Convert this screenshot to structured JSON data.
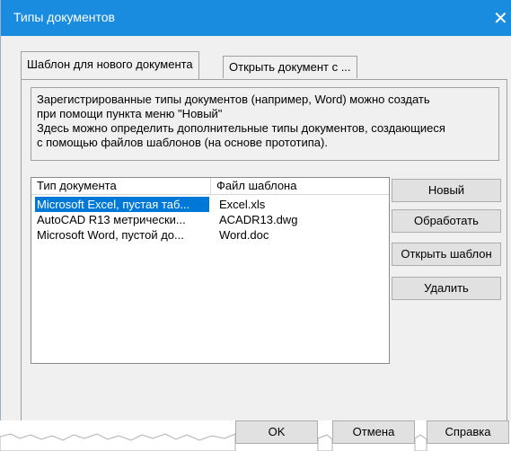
{
  "window": {
    "title": "Типы документов",
    "close_glyph": "✕"
  },
  "tabs": [
    {
      "label": "Шаблон для нового документа",
      "active": true
    },
    {
      "label": "Открыть документ с ...",
      "active": false
    }
  ],
  "description": {
    "lines": [
      "Зарегистрированные типы документов (например, Word) можно создать",
      "при помощи пункта меню \"Новый\"",
      "Здесь можно определить дополнительные типы документов, создающиеся",
      "с помощью файлов шаблонов (на основе прототипа)."
    ]
  },
  "list": {
    "columns": [
      "Тип документа",
      "Файл шаблона"
    ],
    "rows": [
      {
        "type": "Microsoft Excel, пустая таб...",
        "file": "Excel.xls",
        "selected": true
      },
      {
        "type": "AutoCAD R13 метрически...",
        "file": "ACADR13.dwg",
        "selected": false
      },
      {
        "type": "Microsoft Word, пустой до...",
        "file": "Word.doc",
        "selected": false
      }
    ]
  },
  "side_buttons": {
    "new": "Новый",
    "process": "Обработать",
    "open_template": "Открыть шаблон",
    "delete": "Удалить"
  },
  "bottom_buttons": {
    "ok": "OK",
    "cancel": "Отмена",
    "help": "Справка"
  },
  "colors": {
    "titlebar": "#1a8ce0",
    "selection": "#0078d7",
    "dialog_bg": "#f0f0f0"
  }
}
